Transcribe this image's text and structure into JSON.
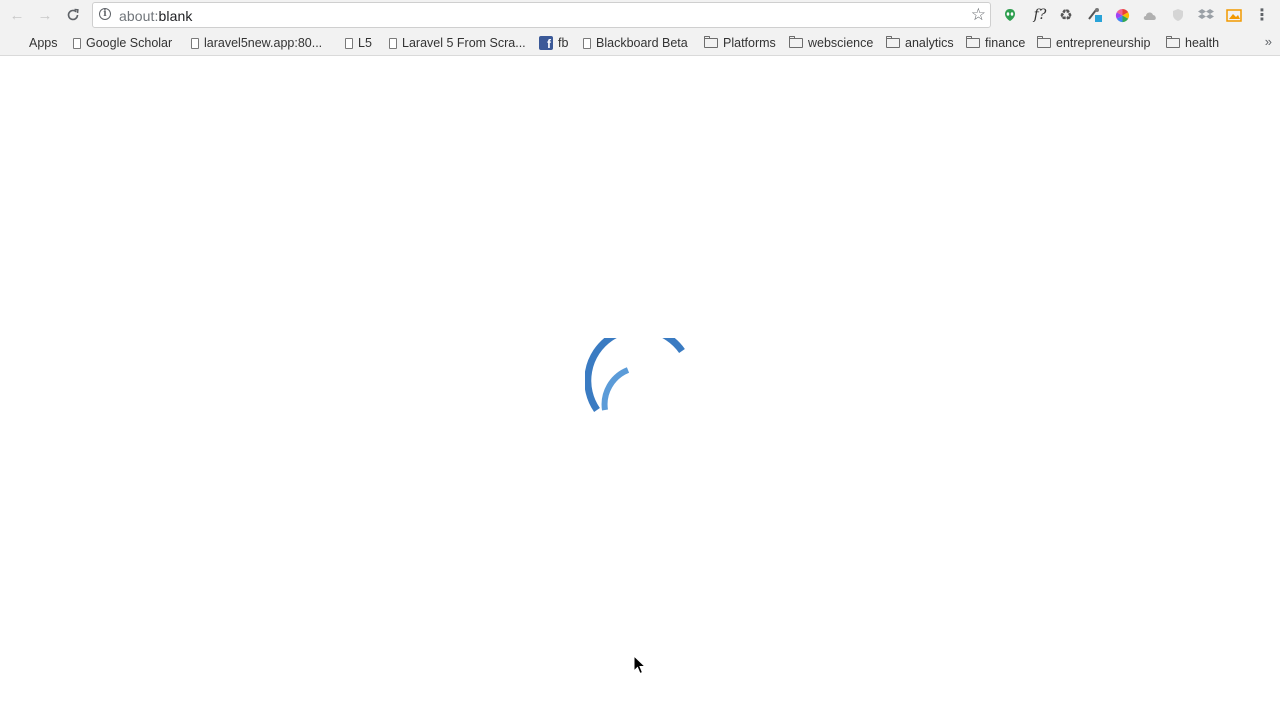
{
  "browser": {
    "omnibox": {
      "scheme": "about:",
      "host": "blank"
    },
    "extensions": [
      {
        "icon": "alien-extension-icon",
        "color": "#2e9e4f"
      },
      {
        "icon": "formula-extension-icon",
        "glyph": "f?"
      },
      {
        "icon": "recycle-extension-icon",
        "glyph": "♻"
      },
      {
        "icon": "tools-extension-icon",
        "color": "#29a3d8"
      },
      {
        "icon": "color-wheel-extension-icon",
        "color": "#e94235"
      },
      {
        "icon": "cloud-extension-icon",
        "color": "#b0b0b0"
      },
      {
        "icon": "shield-extension-icon",
        "color": "#c9c9c9"
      },
      {
        "icon": "dropbox-extension-icon",
        "color": "#9aa0a6"
      },
      {
        "icon": "picture-extension-icon",
        "color": "#f29900"
      }
    ]
  },
  "bookmarks": [
    {
      "label": "Apps",
      "icon": "apps-grid-icon"
    },
    {
      "label": "Google Scholar",
      "icon": "page-icon"
    },
    {
      "label": "laravel5new.app:80...",
      "icon": "page-icon"
    },
    {
      "label": "L5",
      "icon": "page-icon"
    },
    {
      "label": "Laravel 5 From Scra...",
      "icon": "page-icon"
    },
    {
      "label": "fb",
      "icon": "facebook-icon"
    },
    {
      "label": "Blackboard Beta",
      "icon": "page-icon"
    },
    {
      "label": "Platforms",
      "icon": "folder-icon"
    },
    {
      "label": "webscience",
      "icon": "folder-icon"
    },
    {
      "label": "analytics",
      "icon": "folder-icon"
    },
    {
      "label": "finance",
      "icon": "folder-icon"
    },
    {
      "label": "entrepreneurship",
      "icon": "folder-icon"
    },
    {
      "label": "health",
      "icon": "folder-icon"
    }
  ],
  "more_bookmarks_glyph": "»",
  "colors": {
    "spinner_outer": "#3a7bc2",
    "spinner_inner": "#5b9bd8",
    "toolbar_bg": "#f2f2f2"
  }
}
